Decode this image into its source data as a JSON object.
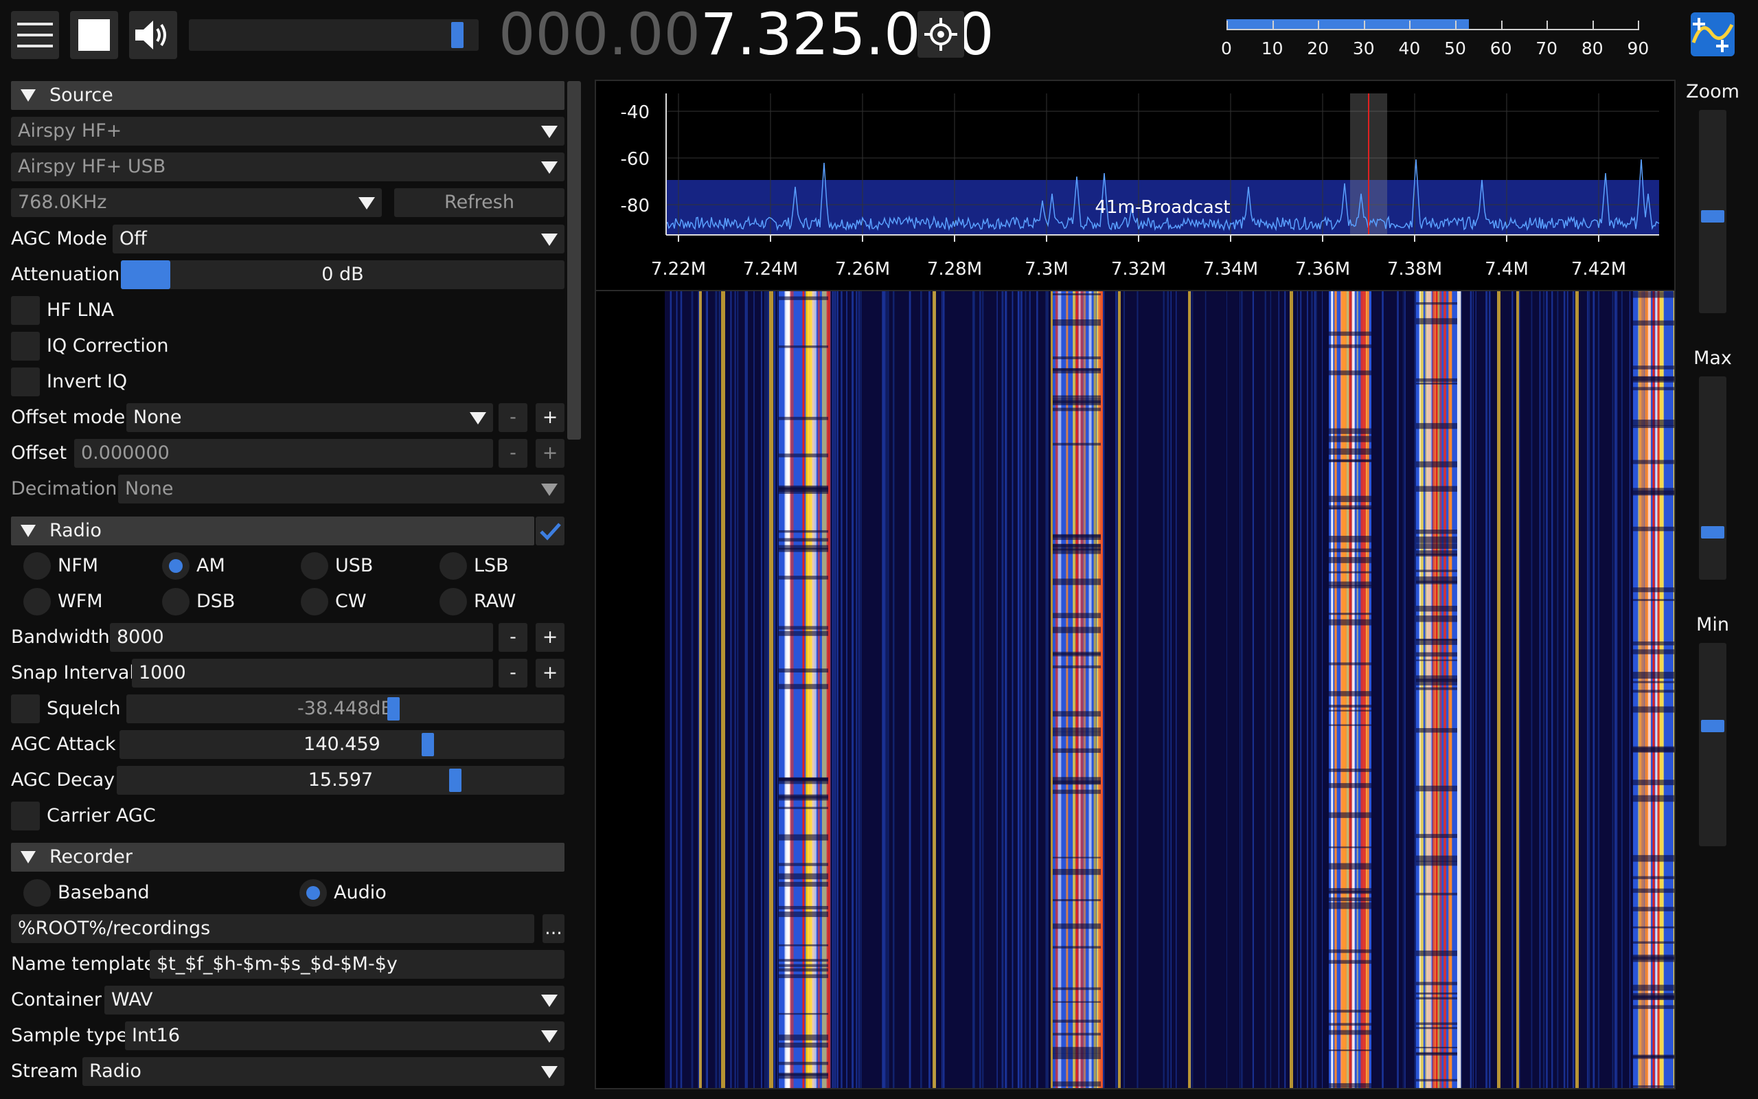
{
  "toolbar": {
    "menu_icon": "hamburger-menu-icon",
    "stop_icon": "stop-square-icon",
    "volume_icon": "speaker-icon",
    "volume_level": 0.96,
    "freq_dim": "000.00",
    "freq_bright": "7.325.000",
    "center_icon": "crosshair-icon",
    "snr_fill_value": 53,
    "snr_ticks": [
      "0",
      "10",
      "20",
      "30",
      "40",
      "50",
      "60",
      "70",
      "80",
      "90"
    ],
    "logo": "sdrpp-logo-icon"
  },
  "source": {
    "header": "Source",
    "device": "Airspy HF+",
    "serial": "Airspy HF+ USB",
    "samplerate": "768.0KHz",
    "refresh": "Refresh",
    "agc_label": "AGC Mode",
    "agc_value": "Off",
    "atten_label": "Attenuation",
    "atten_value": "0 dB",
    "hf_lna": "HF LNA",
    "iq_corr": "IQ Correction",
    "invert_iq": "Invert IQ",
    "offset_mode_label": "Offset mode",
    "offset_mode_value": "None",
    "offset_label": "Offset",
    "offset_value": "0.000000",
    "decimation_label": "Decimation",
    "decimation_value": "None",
    "minus": "-",
    "plus": "+"
  },
  "radio": {
    "header": "Radio",
    "modes": [
      "NFM",
      "AM",
      "USB",
      "LSB",
      "WFM",
      "DSB",
      "CW",
      "RAW"
    ],
    "selected_mode": "AM",
    "bandwidth_label": "Bandwidth",
    "bandwidth_value": "8000",
    "snap_label": "Snap Interval",
    "snap_value": "1000",
    "squelch_label": "Squelch",
    "squelch_value": "-38.448dB",
    "agc_attack_label": "AGC Attack",
    "agc_attack_value": "140.459",
    "agc_decay_label": "AGC Decay",
    "agc_decay_value": "15.597",
    "carrier_agc": "Carrier AGC"
  },
  "recorder": {
    "header": "Recorder",
    "baseband": "Baseband",
    "audio": "Audio",
    "path": "%ROOT%/recordings",
    "browse": "...",
    "name_template_label": "Name template",
    "name_template_value": "$t_$f_$h-$m-$s_$d-$M-$y",
    "container_label": "Container",
    "container_value": "WAV",
    "sample_type_label": "Sample type",
    "sample_type_value": "Int16",
    "stream_label": "Stream",
    "stream_value": "Radio"
  },
  "spectrum": {
    "db_labels": [
      "-40",
      "-60",
      "-80"
    ],
    "freq_labels": [
      "7.22M",
      "7.24M",
      "7.26M",
      "7.28M",
      "7.3M",
      "7.32M",
      "7.34M",
      "7.36M",
      "7.38M",
      "7.4M",
      "7.42M"
    ],
    "band_name": "41m-Broadcast"
  },
  "right": {
    "zoom": "Zoom",
    "max": "Max",
    "min": "Min"
  }
}
